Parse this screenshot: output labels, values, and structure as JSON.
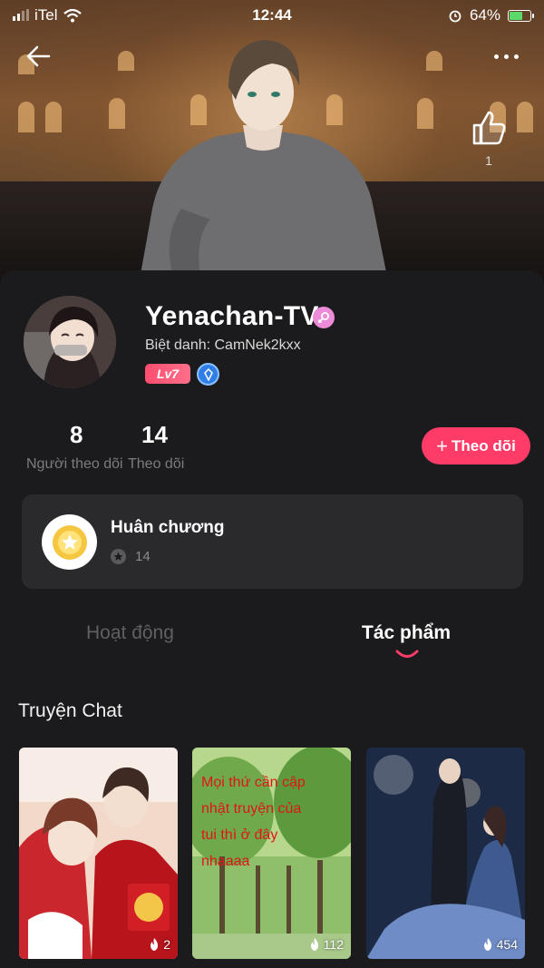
{
  "status_bar": {
    "carrier": "iTel",
    "time": "12:44",
    "battery": "64%"
  },
  "header": {
    "like_count": "1"
  },
  "profile": {
    "name": "Yenachan-TV",
    "nickname_line": "Biệt danh: CamNek2kxx",
    "level": "Lv7",
    "followers_count": "8",
    "followers_label": "Người theo dõi",
    "following_count": "14",
    "following_label": "Theo dõi",
    "follow_button": "Theo dõi"
  },
  "medal": {
    "title": "Huân chương",
    "count": "14"
  },
  "tabs": [
    {
      "label": "Hoạt động",
      "active": false
    },
    {
      "label": "Tác phẩm",
      "active": true
    }
  ],
  "section": {
    "title": "Truyện Chat"
  },
  "stories": [
    {
      "views": "2",
      "overlay_text": ""
    },
    {
      "views": "112",
      "overlay_text": "Mọi thứ cần cập nhật truyện của tui thì ở đây nhaaaa"
    },
    {
      "views": "454",
      "overlay_text": ""
    }
  ],
  "colors": {
    "accent": "#ff3c68",
    "background": "#1b1b1d",
    "card": "#2a2a2d"
  }
}
